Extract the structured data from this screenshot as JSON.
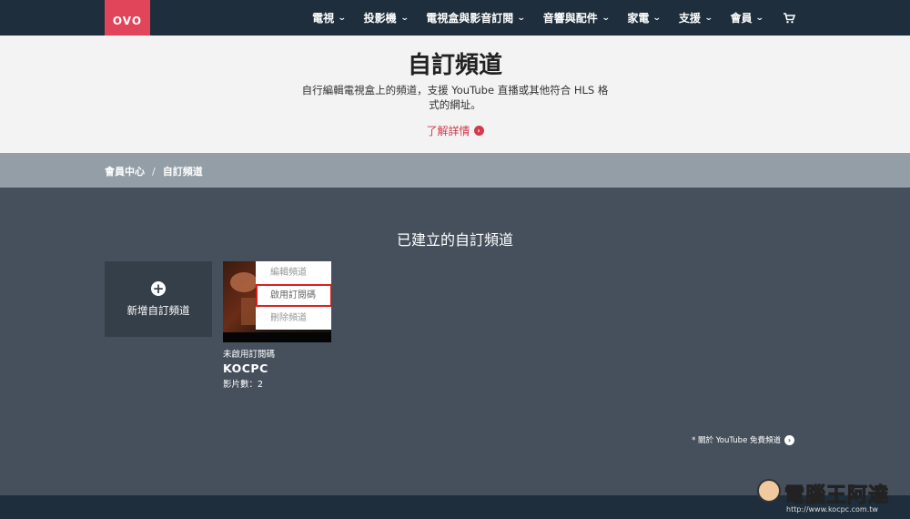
{
  "header": {
    "logo_text": "OVO",
    "nav": [
      "電視",
      "投影機",
      "電視盒與影音訂閱",
      "音響與配件",
      "家電",
      "支援",
      "會員"
    ],
    "cart_icon": "shopping-cart-icon"
  },
  "hero": {
    "title": "自訂頻道",
    "description": "自行編輯電視盒上的頻道，支援 YouTube 直播或其他符合 HLS 格式的網址。",
    "learn_more": "了解詳情"
  },
  "breadcrumb": {
    "home": "會員中心",
    "separator": "/",
    "current": "自訂頻道"
  },
  "main": {
    "section_title": "已建立的自訂頻道",
    "add_channel_label": "新增自訂頻道",
    "channel": {
      "menu": [
        "編輯頻道",
        "啟用訂閱碼",
        "刪除頻道"
      ],
      "status": "未啟用訂閱碼",
      "name": "KOCPC",
      "video_count": "影片數：2"
    },
    "youtube_note": "* 關於 YouTube 免費頻道"
  },
  "watermark": {
    "text": "電腦王阿達",
    "url": "http://www.kocpc.com.tw"
  },
  "colors": {
    "nav_bg": "#1e2e3c",
    "brand": "#e0455a",
    "link": "#d03a4c",
    "main_bg": "#46505c",
    "highlight_box": "#e01e1e"
  }
}
